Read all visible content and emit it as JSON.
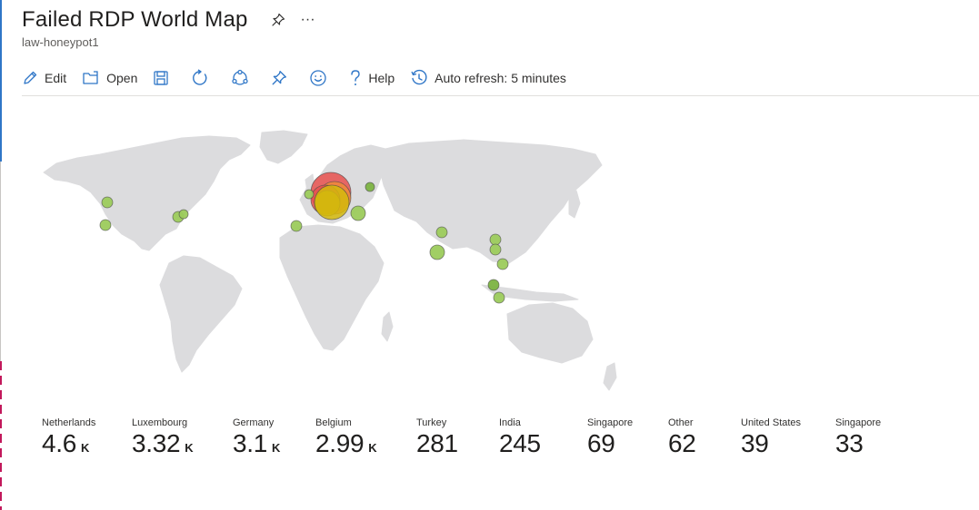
{
  "header": {
    "title": "Failed RDP World Map",
    "subtitle": "law-honeypot1",
    "more_label": "···"
  },
  "toolbar": {
    "edit_label": "Edit",
    "open_label": "Open",
    "help_label": "Help",
    "auto_refresh_label": "Auto refresh: 5 minutes"
  },
  "icons": {
    "edit": "pencil-icon",
    "open": "folder-open-icon",
    "save": "save-icon",
    "refresh": "refresh-icon",
    "share": "share-icon",
    "pin": "pin-icon",
    "feedback": "smiley-icon",
    "help": "help-icon",
    "auto_refresh": "clock-icon"
  },
  "colors": {
    "land": "#dcdcde",
    "bubble_small": "#9ccb5c",
    "bubble_dark": "#7cb342",
    "bubble_large_red": "#e8514f",
    "bubble_large_orange": "#f08a3a",
    "bubble_large_yellow": "#d4b80d"
  },
  "tiles": [
    {
      "name": "Netherlands",
      "value": "4.6",
      "unit": "K"
    },
    {
      "name": "Luxembourg",
      "value": "3.32",
      "unit": "K"
    },
    {
      "name": "Germany",
      "value": "3.1",
      "unit": "K"
    },
    {
      "name": "Belgium",
      "value": "2.99",
      "unit": "K"
    },
    {
      "name": "Turkey",
      "value": "281",
      "unit": ""
    },
    {
      "name": "India",
      "value": "245",
      "unit": ""
    },
    {
      "name": "Singapore",
      "value": "69",
      "unit": ""
    },
    {
      "name": "Other",
      "value": "62",
      "unit": ""
    },
    {
      "name": "United States",
      "value": "39",
      "unit": ""
    },
    {
      "name": "Singapore",
      "value": "33",
      "unit": ""
    }
  ]
}
